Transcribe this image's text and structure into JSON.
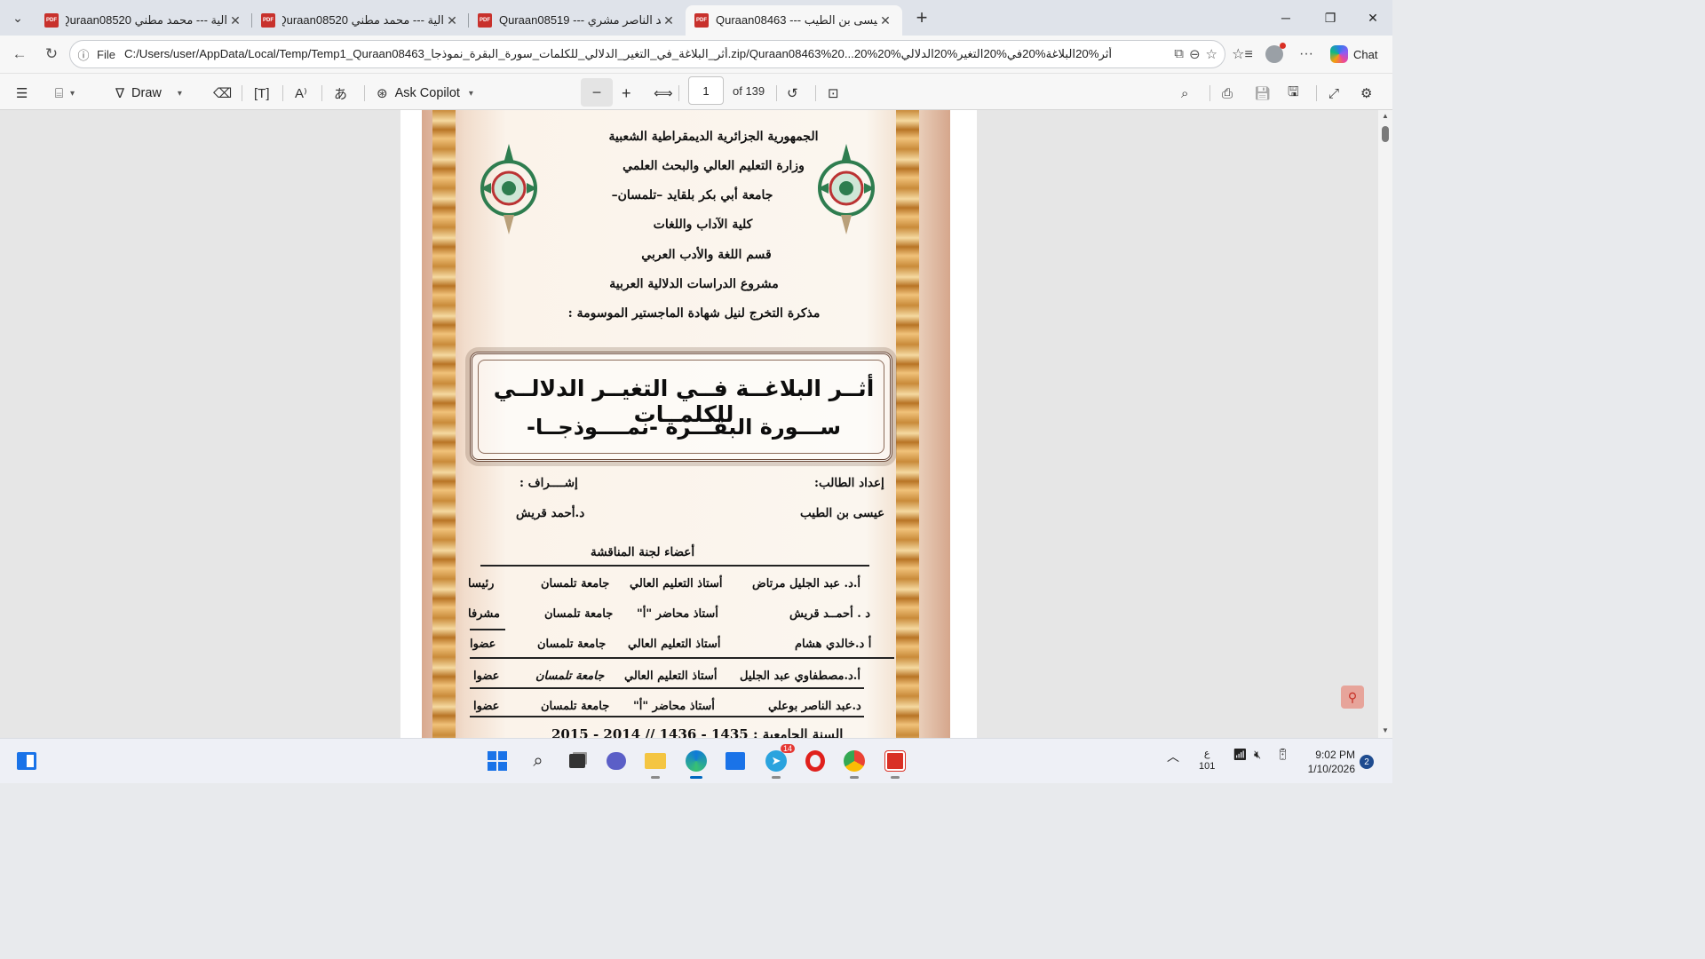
{
  "tabs": [
    {
      "title": "الية --- محمد مطني Quraan08520"
    },
    {
      "title": "الية --- محمد مطني Quraan08520"
    },
    {
      "title": "Quraan08519 --- عبد الناصر مشري"
    },
    {
      "title": "Quraan08463 --- عيسى بن الطيب"
    }
  ],
  "address": {
    "scheme_label": "File",
    "url": "C:/Users/user/AppData/Local/Temp/Temp1_Quraan08463_أثر_البلاغة_في_التغير_الدلالي_للكلمات_سورة_البقرة_نموذجا.zip/Quraan08463%20...20%أثر%20البلاغة%20في%20التغير%20الدلالي%20"
  },
  "chat_label": "Chat",
  "pdf_toolbar": {
    "draw_label": "Draw",
    "copilot_label": "Ask Copilot",
    "page_value": "1",
    "page_of": "of 139"
  },
  "document": {
    "header": [
      "الجمهورية الجزائرية الديمقراطية الشعبية",
      "وزارة التعليم العالي والبحث العلمي",
      "جامعة أبي بكر بلقايد –تلمسان–",
      "كلية الآداب واللغات",
      "قسم اللغة والأدب العربي",
      "مشروع الدراسات الدلالية العربية",
      "مذكرة التخرج لنيل شهادة الماجستير الموسومة :"
    ],
    "title_line1": "أثــر البلاغــة فــي التغيــر الدلالــي للكلمــات",
    "title_line2": "ســـورة البقـــرة -نمــــوذجــا-",
    "prepared_by_label": "إعداد الطالب:",
    "student_name": "عيسى بن الطيب",
    "supervision_label": "إشــــراف :",
    "supervisor_name": "د.أحمد قريش",
    "committee_title": "أعضاء لجنة المناقشة",
    "committee": [
      {
        "name": "أ.د. عبد الجليل مرتاض",
        "rank": "أستاذ التعليم العالي",
        "university": "جامعة تلمسان",
        "role": "رئيسا"
      },
      {
        "name": "د . أحمــد قريش",
        "rank": "أستاذ محاضر \"أ\"",
        "university": "جامعة تلمسان",
        "role": "مشرفا"
      },
      {
        "name": "أ د.خالدي هشام",
        "rank": "أستاذ التعليم العالي",
        "university": "جامعة تلمسان",
        "role": "عضوا"
      },
      {
        "name": "أ.د.مصطفاوي عبد الجليل",
        "rank": "أستاذ التعليم العالي",
        "university": "جامعة تلمسان",
        "role": "عضوا"
      },
      {
        "name": "د.عبد الناصر بوعلي",
        "rank": "أستاذ محاضر \"أ\"",
        "university": "جامعة تلمسان",
        "role": "عضوا"
      }
    ],
    "year_line": "السنة الجامعية : 1435 - 1436 // 2014 - 2015"
  },
  "taskbar": {
    "telegram_badge": "14",
    "lang_top": "ع",
    "lang_bottom": "101",
    "time": "9:02 PM",
    "date": "1/10/2026",
    "notifications": "2"
  },
  "colors": {
    "pdf_red": "#c8312c",
    "frame_gold": "#c98b3a",
    "accent_blue": "#0067c0"
  }
}
